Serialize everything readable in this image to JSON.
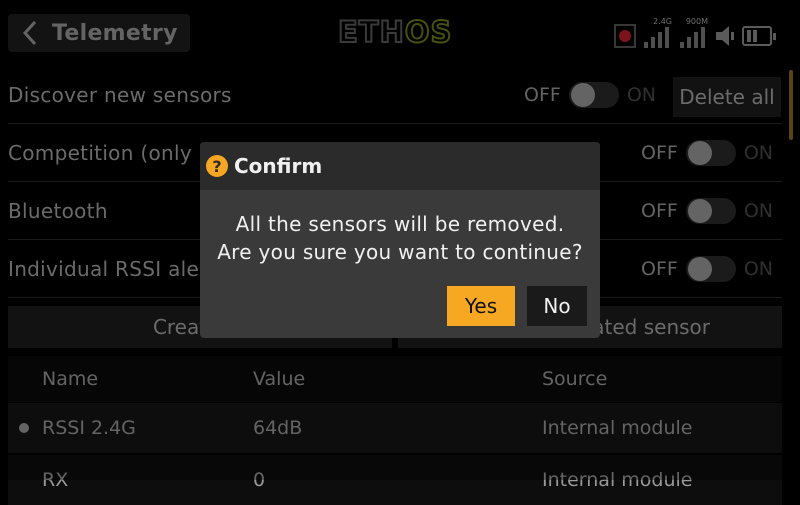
{
  "header": {
    "title": "Telemetry",
    "logo_part1": "ETH",
    "logo_part2": "OS",
    "signal1_label": "2.4G",
    "signal2_label": "900M"
  },
  "settings": {
    "discover_label": "Discover new sensors",
    "competition_label": "Competition (only F",
    "bluetooth_label": "Bluetooth",
    "rssi_alert_label": "Individual RSSI aler",
    "off": "OFF",
    "on": "ON",
    "delete_all": "Delete all",
    "create_btn": "Create DI",
    "calc_btn": "ated sensor"
  },
  "table": {
    "columns": [
      "Name",
      "Value",
      "Source"
    ],
    "rows": [
      {
        "name": "RSSI 2.4G",
        "value": "64dB",
        "source": "Internal module"
      },
      {
        "name": "RX",
        "value": "0",
        "source": "Internal module"
      }
    ]
  },
  "dialog": {
    "title": "Confirm",
    "icon": "question-icon",
    "line1": "All the sensors will be removed.",
    "line2": "Are you sure you want to continue?",
    "yes": "Yes",
    "no": "No"
  },
  "colors": {
    "accent": "#f7a823",
    "record": "#c0202a",
    "logo_os": "#6a7d1c"
  }
}
